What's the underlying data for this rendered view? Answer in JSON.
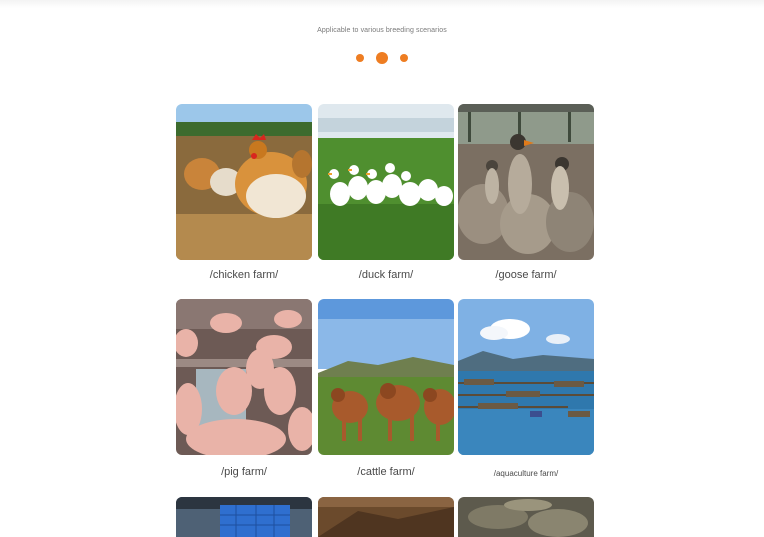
{
  "header": {
    "subtitle": "Applicable to various breeding scenarios"
  },
  "carousel": {
    "dots": 3,
    "active_index": 1,
    "accent_color": "#ee7d22"
  },
  "farms": [
    {
      "label": "/chicken farm/",
      "image": "chicken-farm-photo"
    },
    {
      "label": "/duck farm/",
      "image": "duck-farm-photo"
    },
    {
      "label": "/goose farm/",
      "image": "goose-farm-photo"
    },
    {
      "label": "/pig farm/",
      "image": "pig-farm-photo"
    },
    {
      "label": "/cattle farm/",
      "image": "cattle-farm-photo"
    },
    {
      "label": "/aquaculture farm/",
      "image": "aquaculture-farm-photo"
    }
  ]
}
